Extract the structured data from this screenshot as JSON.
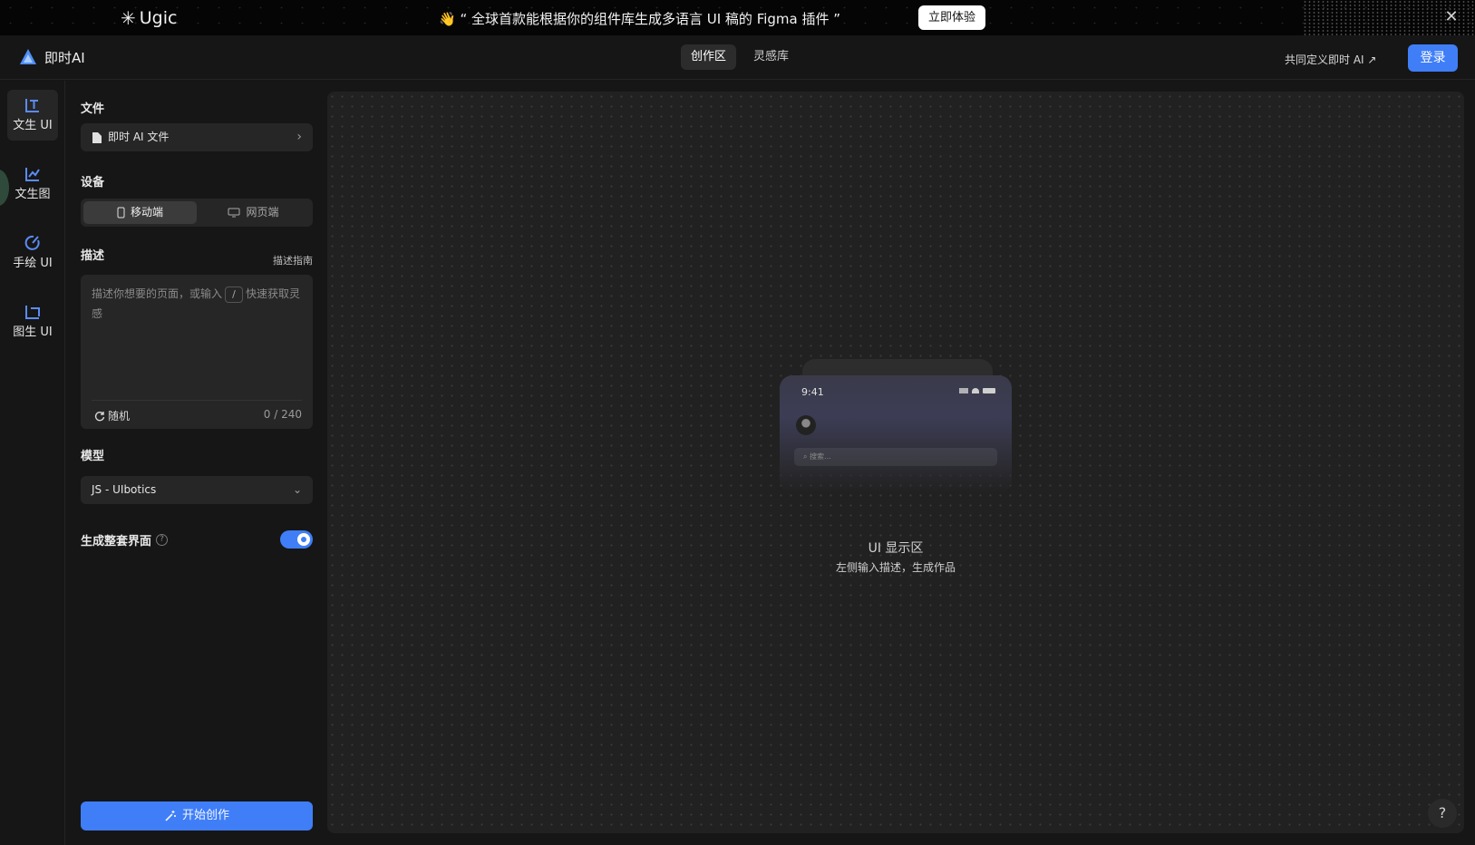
{
  "banner": {
    "brand": "Ugic",
    "message": "👋 “ 全球首款能根据你的组件库生成多语言 UI 稿的 Figma 插件 ”",
    "cta": "立即体验",
    "close_icon": "close-icon"
  },
  "header": {
    "app_name": "即时AI",
    "tabs": [
      {
        "label": "创作区",
        "active": true
      },
      {
        "label": "灵感库",
        "active": false
      }
    ],
    "cooperate_link": "共同定义即时 AI ↗",
    "login": "登录",
    "accent_color": "#3f7ef7"
  },
  "rail": {
    "items": [
      {
        "label": "文生 UI",
        "icon": "text-to-ui-icon",
        "active": true
      },
      {
        "label": "文生图",
        "icon": "text-to-image-icon",
        "active": false
      },
      {
        "label": "手绘 UI",
        "icon": "sketch-icon",
        "active": false
      },
      {
        "label": "图生 UI",
        "icon": "image-to-ui-icon",
        "active": false
      }
    ]
  },
  "panel": {
    "file_title": "文件",
    "file_value": "即时 AI 文件",
    "device_title": "设备",
    "device_options": [
      {
        "label": "移动端",
        "icon": "mobile-icon",
        "selected": true
      },
      {
        "label": "网页端",
        "icon": "desktop-icon",
        "selected": false
      }
    ],
    "desc_title": "描述",
    "desc_guide": "描述指南",
    "desc_placeholder_before": "描述你想要的页面，或输入",
    "desc_placeholder_key": "/",
    "desc_placeholder_after": "快速获取灵感",
    "random_label": "随机",
    "char_counter": "0 / 240",
    "model_title": "模型",
    "model_value": "JS - UIbotics",
    "full_ui_label": "生成整套界面",
    "full_ui_enabled": true,
    "start_button": "开始创作"
  },
  "canvas": {
    "mock_time": "9:41",
    "mock_search": "搜索...",
    "title": "UI 显示区",
    "subtitle": "左侧输入描述，生成作品"
  },
  "help_fab": "?"
}
